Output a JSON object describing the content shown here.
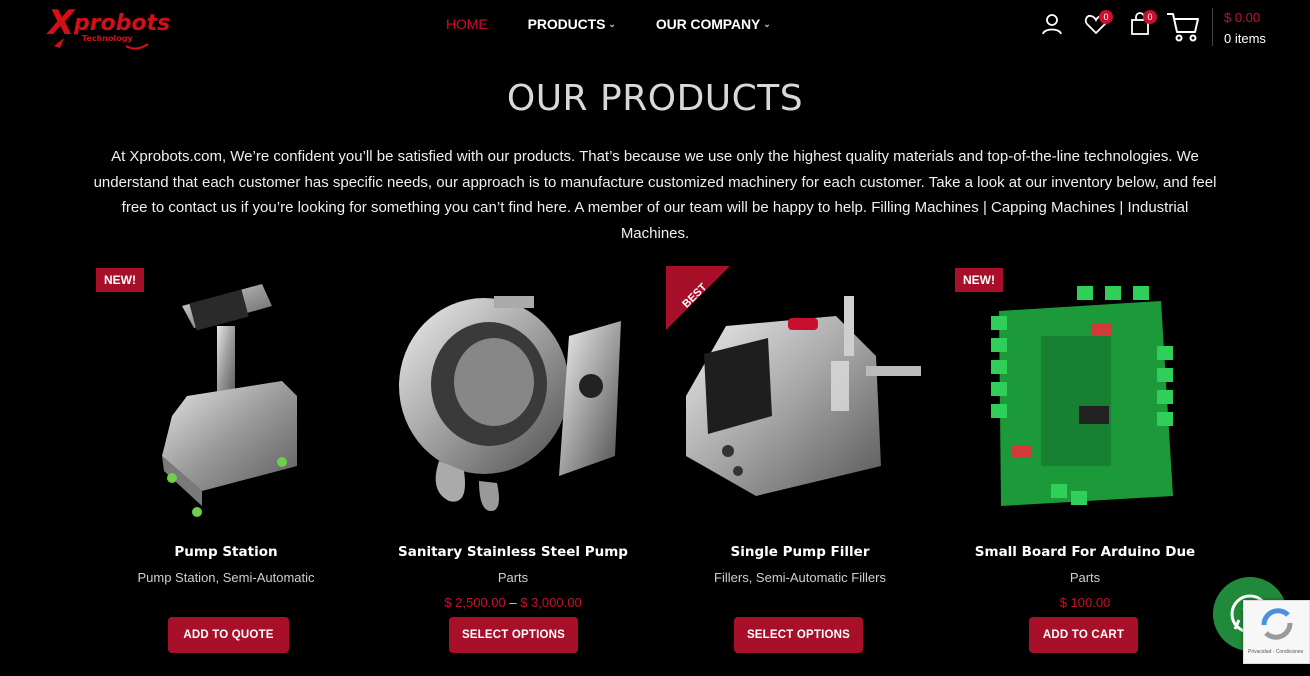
{
  "header": {
    "logo_alt": "Xprobots Technology",
    "nav": [
      {
        "label": "HOME",
        "active": true,
        "has_dropdown": false
      },
      {
        "label": "PRODUCTS",
        "active": false,
        "has_dropdown": true
      },
      {
        "label": "OUR COMPANY",
        "active": false,
        "has_dropdown": true
      }
    ],
    "icons": [
      "user-icon",
      "heart-icon",
      "bag-icon",
      "cart-icon"
    ],
    "wishlist_count": "0",
    "compare_count": "0",
    "cart_total": "$ 0.00",
    "cart_items": "0 items"
  },
  "page": {
    "title": "OUR PRODUCTS",
    "intro": "At Xprobots.com, We’re confident you’ll be satisfied with our products. That’s because we use only the highest quality materials and top-of-the-line technologies. We understand that each customer has specific needs, our approach is to manufacture customized machinery for each customer. Take a look at our inventory below, and feel free to contact us if you’re looking for something you can’t find here. A member of our team will be happy to help. Filling Machines | Capping Machines | Industrial Machines."
  },
  "products": [
    {
      "name": "Pump Station",
      "category": "Pump Station, Semi-Automatic",
      "price_low": "",
      "price_high": "",
      "price": "",
      "button": "ADD TO QUOTE",
      "label": "NEW!"
    },
    {
      "name": "Sanitary Stainless Steel Pump",
      "category": "Parts",
      "price_low": "$ 2,500.00",
      "price_high": "$ 3,000.00",
      "price": "",
      "button": "SELECT OPTIONS",
      "label": ""
    },
    {
      "name": "Single Pump Filler",
      "category": "Fillers, Semi-Automatic Fillers",
      "price_low": "",
      "price_high": "",
      "price": "",
      "button": "SELECT OPTIONS",
      "label": "BEST"
    },
    {
      "name": "Small Board For Arduino Due",
      "category": "Parts",
      "price_low": "",
      "price_high": "",
      "price": "$ 100.00",
      "button": "ADD TO CART",
      "label": "NEW!"
    }
  ],
  "price_separator": "–",
  "recaptcha_text": "Privacidad - Condiciones",
  "colors": {
    "accent": "#c8102e",
    "button": "#a8102a",
    "chat": "#1f8a3a",
    "background": "#000000"
  }
}
